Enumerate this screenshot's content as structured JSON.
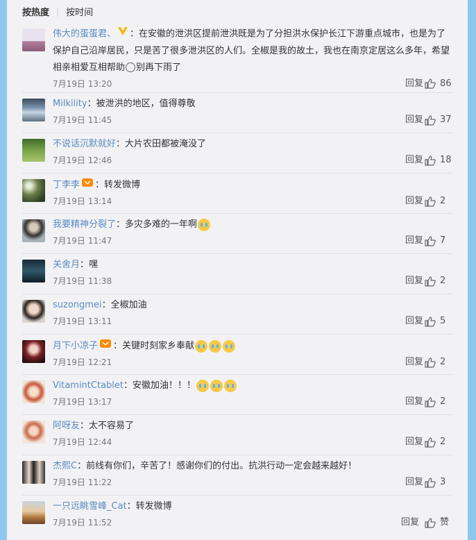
{
  "sort": {
    "hot": "按热度",
    "time": "按时间"
  },
  "reply_label": "回复",
  "comments": [
    {
      "name": "伟大的蛋蛋君、",
      "text": "：在安徽的泄洪区提前泄洪既是为了分担洪水保护长江下游重点城市，也是为了保护自己沿岸居民，只是苦了很多泄洪区的人们。全椒是我的故土，我也在南京定居这么多年，希望相亲相爱互相帮助",
      "text2": "别再下雨了",
      "time": "7月19日 13:20",
      "likes": "86"
    },
    {
      "name": "Milkility",
      "text": "：被泄洪的地区，值得尊敬",
      "time": "7月19日 11:45",
      "likes": "37"
    },
    {
      "name": "不说话沉默就好",
      "text": "：大片农田都被淹没了",
      "time": "7月19日 12:46",
      "likes": "18"
    },
    {
      "name": "丁李李",
      "text": "：转发微博",
      "time": "7月19日 13:14",
      "likes": "2"
    },
    {
      "name": "我要精神分裂了",
      "text": "：多灾多难的一年啊",
      "time": "7月19日 11:47",
      "likes": "7"
    },
    {
      "name": "关舍月",
      "text": "：嘿",
      "time": "7月19日 11:38",
      "likes": "2"
    },
    {
      "name": "suzongmei",
      "text": "：全椒加油",
      "time": "7月19日 13:11",
      "likes": "5"
    },
    {
      "name": "月下小凉子",
      "text": "：关键时刻家乡奉献",
      "time": "7月19日 12:21",
      "likes": "2"
    },
    {
      "name": "VitamintCtablet",
      "text": "：安徽加油！！！",
      "time": "7月19日 13:17",
      "likes": "2"
    },
    {
      "name": "阿呀友",
      "text": "：太不容易了",
      "time": "7月19日 12:44",
      "likes": "2"
    },
    {
      "name": "杰熙C",
      "text": "：前线有你们，辛苦了！感谢你们的付出。抗洪行动一定会越来越好！",
      "time": "7月19日 11:22",
      "likes": "3"
    },
    {
      "name": "一只远眺雪峰_Cat",
      "text": "：转发微博",
      "time": "7月19日 11:52",
      "likes": "赞"
    }
  ]
}
